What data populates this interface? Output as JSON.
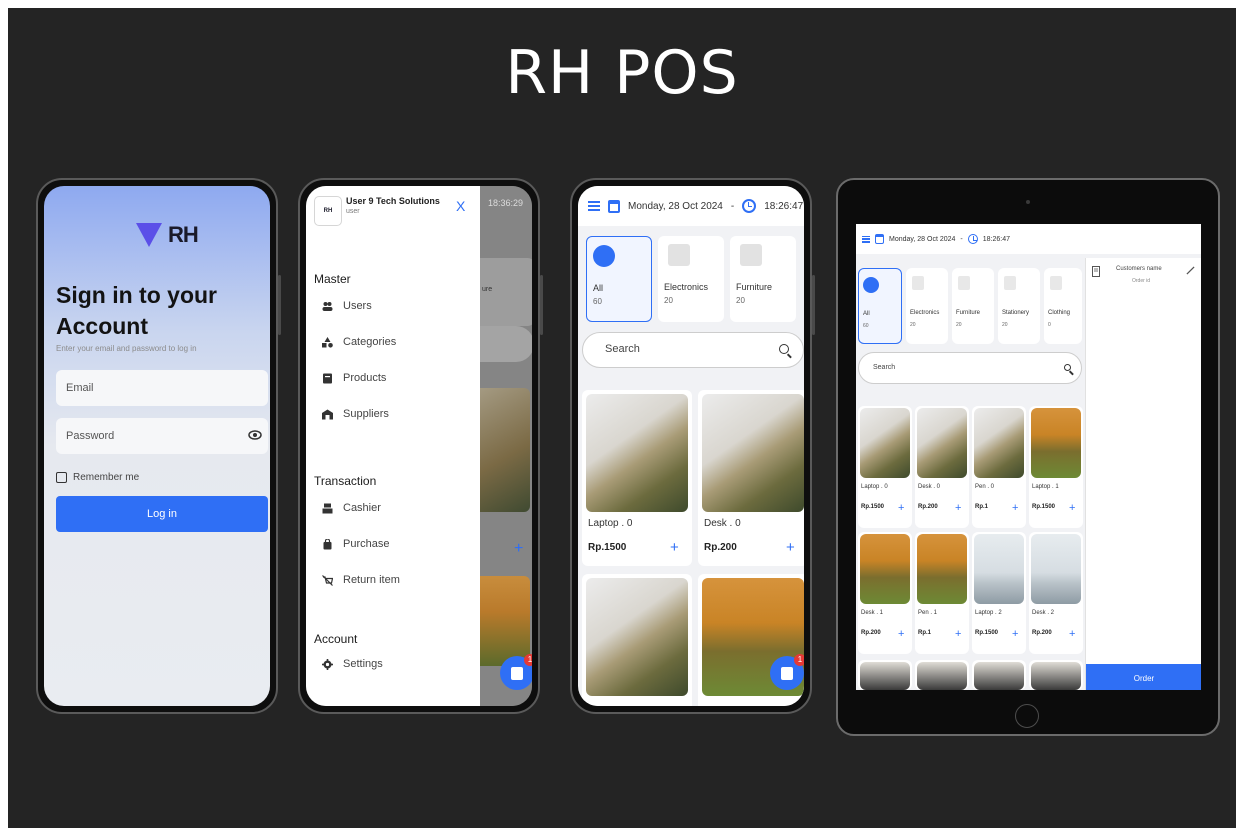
{
  "title": "RH POS",
  "colors": {
    "background": "#242424",
    "accent": "#2f6ff5",
    "badge": "#e53935"
  },
  "login": {
    "logo_text": "RH",
    "heading": "Sign in to your Account",
    "subtitle": "Enter your email and password to log in",
    "email_placeholder": "Email",
    "password_placeholder": "Password",
    "remember_label": "Remember me",
    "login_button": "Log in"
  },
  "drawer": {
    "avatar_text": "RH",
    "user_name": "User 9 Tech Solutions",
    "user_role": "user",
    "close_label": "X",
    "bg_time": "18:36:29",
    "bg_category": "ure",
    "sections": [
      {
        "title": "Master",
        "items": [
          {
            "label": "Users",
            "icon": "users-icon"
          },
          {
            "label": "Categories",
            "icon": "categories-icon"
          },
          {
            "label": "Products",
            "icon": "products-icon"
          },
          {
            "label": "Suppliers",
            "icon": "suppliers-icon"
          }
        ]
      },
      {
        "title": "Transaction",
        "items": [
          {
            "label": "Cashier",
            "icon": "cashier-icon"
          },
          {
            "label": "Purchase",
            "icon": "purchase-icon"
          },
          {
            "label": "Return item",
            "icon": "return-icon"
          }
        ]
      },
      {
        "title": "Account",
        "items": [
          {
            "label": "Settings",
            "icon": "gear-icon"
          }
        ]
      }
    ],
    "cart_badge": "1"
  },
  "mobile_pos": {
    "date": "Monday, 28 Oct 2024",
    "separator": "-",
    "time": "18:26:47",
    "categories": [
      {
        "name": "All",
        "count": "60"
      },
      {
        "name": "Electronics",
        "count": "20"
      },
      {
        "name": "Furniture",
        "count": "20"
      }
    ],
    "search_placeholder": "Search",
    "products": [
      {
        "name": "Laptop . 0",
        "price": "Rp.1500",
        "image": "hillside"
      },
      {
        "name": "Desk . 0",
        "price": "Rp.200",
        "image": "hillside"
      },
      {
        "name": "",
        "price": "",
        "image": "hillside"
      },
      {
        "name": "",
        "price": "",
        "image": "sunset-trees"
      }
    ],
    "add_symbol": "+",
    "cart_badge": "1"
  },
  "tablet_pos": {
    "date": "Monday, 28 Oct 2024",
    "separator": "-",
    "time": "18:26:47",
    "categories": [
      {
        "name": "All",
        "count": "60"
      },
      {
        "name": "Electronics",
        "count": "20"
      },
      {
        "name": "Furniture",
        "count": "20"
      },
      {
        "name": "Stationery",
        "count": "20"
      },
      {
        "name": "Clothing",
        "count": "0"
      }
    ],
    "search_placeholder": "Search",
    "products": [
      {
        "name": "Laptop . 0",
        "price": "Rp.1500",
        "image": "hillside"
      },
      {
        "name": "Desk . 0",
        "price": "Rp.200",
        "image": "hillside"
      },
      {
        "name": "Pen . 0",
        "price": "Rp.1",
        "image": "hillside"
      },
      {
        "name": "Laptop . 1",
        "price": "Rp.1500",
        "image": "sunset-trees"
      },
      {
        "name": "Desk . 1",
        "price": "Rp.200",
        "image": "sunset-trees"
      },
      {
        "name": "Pen . 1",
        "price": "Rp.1",
        "image": "sunset-trees"
      },
      {
        "name": "Laptop . 2",
        "price": "Rp.1500",
        "image": "beach"
      },
      {
        "name": "Desk . 2",
        "price": "Rp.200",
        "image": "beach"
      }
    ],
    "add_symbol": "+",
    "customer_label": "Customers name",
    "order_id_label": "Order id",
    "order_button": "Order"
  }
}
